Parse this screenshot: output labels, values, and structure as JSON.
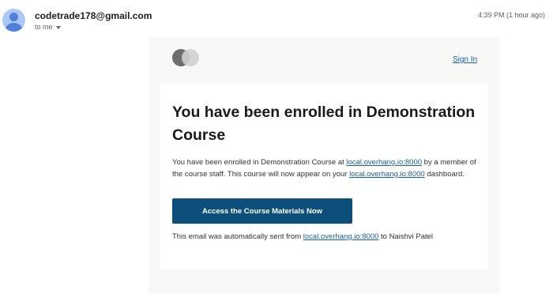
{
  "email": {
    "sender": "codetrade178@gmail.com",
    "recipient_label": "to me",
    "time": "4:39 PM (1 hour ago)"
  },
  "message": {
    "sign_in_label": "Sign In",
    "title": "You have been enrolled in Demonstration Course",
    "body": {
      "part1": "You have been enrolled in Demonstration Course at ",
      "link1": "local.overhang.io:8000",
      "part2": " by a member of the course staff. This course will now appear on your ",
      "link2": "local.overhang.io:8000",
      "part3": " dashboard."
    },
    "cta_label": "Access the Course Materials Now",
    "footer": {
      "part1": "This email was automatically sent from ",
      "link": "local.overhang.io:8000",
      "part2": " to Naishvi Patel"
    }
  },
  "icons": {
    "avatar": "person-avatar-icon",
    "dropdown": "chevron-down-icon",
    "logo": "brand-logo-icon"
  }
}
